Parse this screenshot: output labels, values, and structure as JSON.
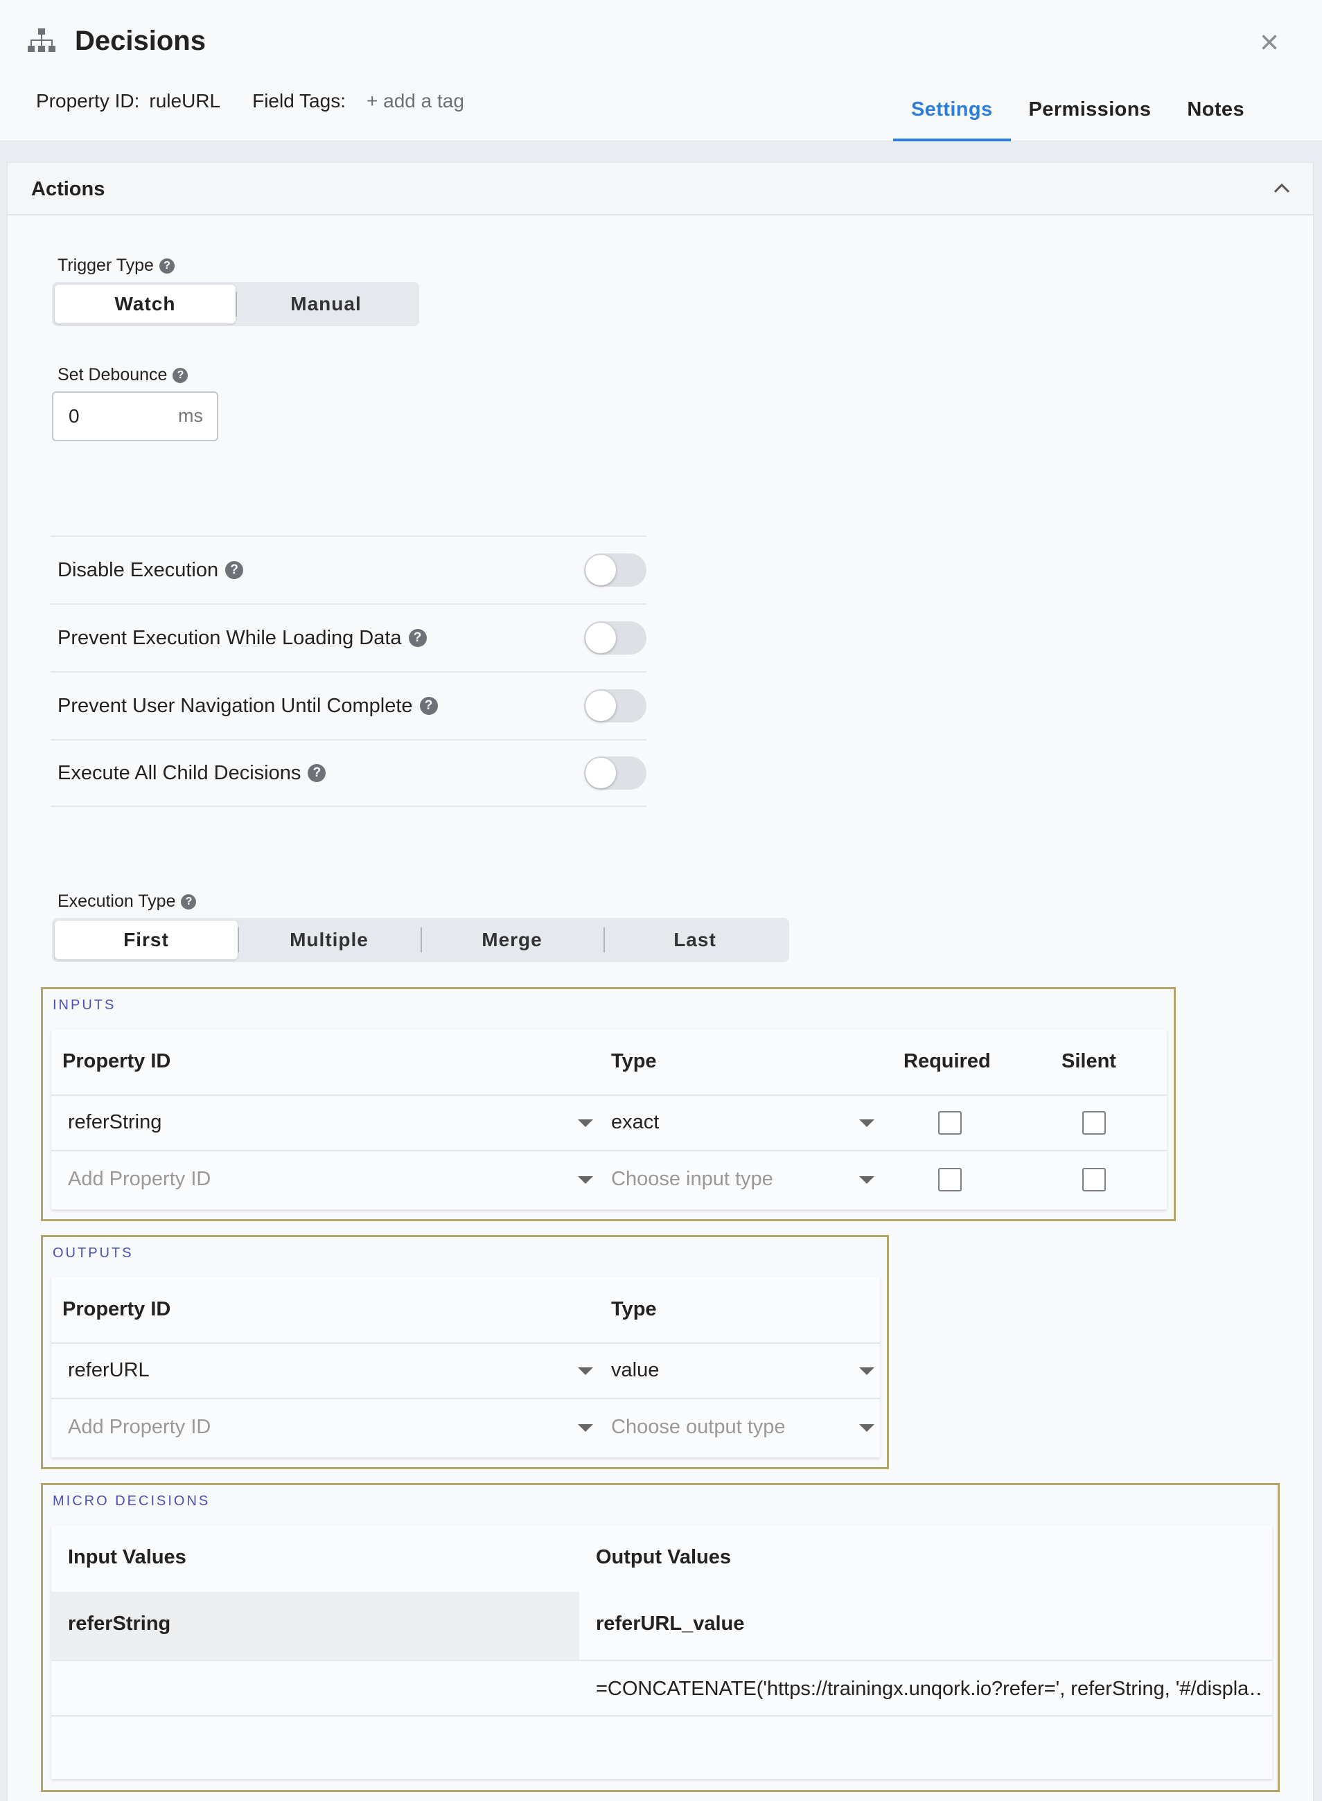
{
  "header": {
    "title": "Decisions",
    "title_icon": "sitemap-icon",
    "close_symbol": "×",
    "property_id_label": "Property ID:",
    "property_id_value": "ruleURL",
    "field_tags_label": "Field Tags:",
    "add_tag": "+ add a tag",
    "tabs": [
      "Settings",
      "Permissions",
      "Notes"
    ],
    "active_tab": "Settings",
    "accent_color": "#2d7fd6"
  },
  "panel": {
    "title": "Actions",
    "trigger_type": {
      "label": "Trigger Type",
      "options": [
        "Watch",
        "Manual"
      ],
      "selected": "Watch"
    },
    "debounce": {
      "label": "Set Debounce",
      "value": "0",
      "unit": "ms"
    },
    "toggles": [
      {
        "label": "Disable Execution",
        "on": false
      },
      {
        "label": "Prevent Execution While Loading Data",
        "on": false
      },
      {
        "label": "Prevent User Navigation Until Complete",
        "on": false
      },
      {
        "label": "Execute All Child Decisions",
        "on": false
      }
    ],
    "execution_type": {
      "label": "Execution Type",
      "options": [
        "First",
        "Multiple",
        "Merge",
        "Last"
      ],
      "selected": "First"
    }
  },
  "inputs": {
    "title": "INPUTS",
    "columns": [
      "Property ID",
      "Type",
      "Required",
      "Silent"
    ],
    "rows": [
      {
        "property_id": "referString",
        "type": "exact",
        "required": false,
        "silent": false
      },
      {
        "property_id_placeholder": "Add Property ID",
        "type_placeholder": "Choose input type",
        "required": false,
        "silent": false
      }
    ]
  },
  "outputs": {
    "title": "OUTPUTS",
    "columns": [
      "Property ID",
      "Type"
    ],
    "rows": [
      {
        "property_id": "referURL",
        "type": "value"
      },
      {
        "property_id_placeholder": "Add Property ID",
        "type_placeholder": "Choose output type"
      }
    ]
  },
  "micro_decisions": {
    "title": "MICRO DECISIONS",
    "columns": [
      "Input Values",
      "Output Values"
    ],
    "header_row": {
      "input": "referString",
      "output": "referURL_value"
    },
    "rows": [
      {
        "input": "",
        "output": "=CONCATENATE('https://trainingx.unqork.io?refer=', referString, '#/displa…"
      }
    ]
  },
  "colors": {
    "section_border": "#b5a46a",
    "section_title": "#4b4fb6"
  }
}
